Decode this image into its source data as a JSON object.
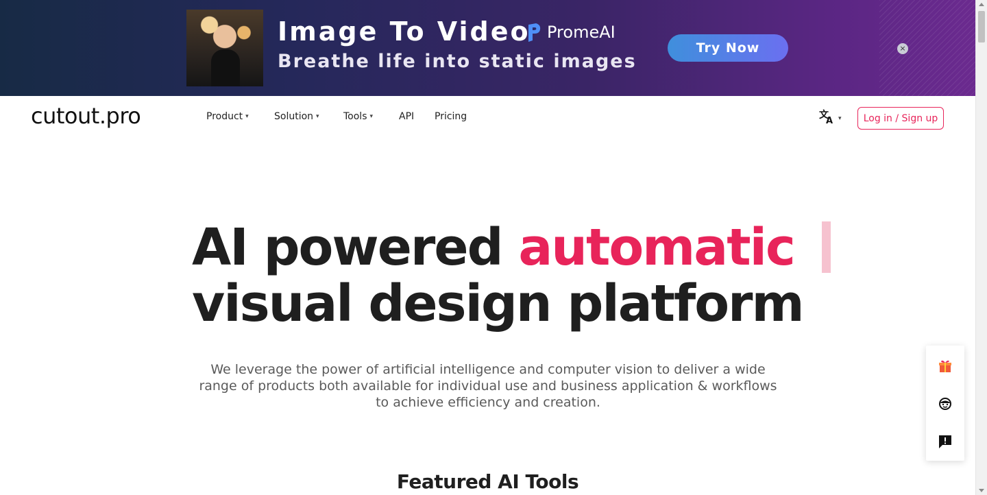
{
  "ad": {
    "title": "Image To Video",
    "subtitle": "Breathe life into static images",
    "brand": "PromeAI",
    "cta": "Try Now",
    "close_icon": "×"
  },
  "header": {
    "logo": "cutout.pro",
    "nav": [
      {
        "label": "Product",
        "has_dropdown": true
      },
      {
        "label": "Solution",
        "has_dropdown": true
      },
      {
        "label": "Tools",
        "has_dropdown": true
      },
      {
        "label": "API",
        "has_dropdown": false
      },
      {
        "label": "Pricing",
        "has_dropdown": false
      }
    ],
    "language_icon": "translate-icon",
    "login_label": "Log in / Sign up"
  },
  "hero": {
    "line1_prefix": "AI powered ",
    "line1_highlight": "automatic",
    "line2": "visual design platform",
    "description": "We leverage the power of artificial intelligence and computer vision to deliver a wide range of products both available for individual use and business application & workflows to achieve efficiency and creation."
  },
  "featured": {
    "title": "Featured AI Tools"
  },
  "side_tools": [
    "gift-icon",
    "support-agent-icon",
    "feedback-icon"
  ],
  "colors": {
    "accent": "#e8245a",
    "caret": "#f6c2cf",
    "ad_button_start": "#3f8fdc",
    "ad_button_end": "#6b6ff0"
  }
}
